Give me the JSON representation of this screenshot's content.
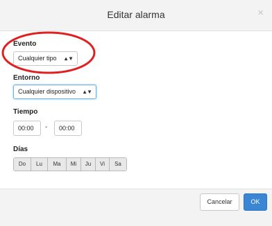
{
  "dialog": {
    "title": "Editar alarma",
    "close_label": "×"
  },
  "evento": {
    "label": "Evento",
    "value": "Cualquier tipo",
    "arrow": "▲▼"
  },
  "entorno": {
    "label": "Entorno",
    "value": "Cualquier dispositivo",
    "arrow": "▲▼"
  },
  "tiempo": {
    "label": "Tiempo",
    "start": "00:00",
    "separator": "-",
    "end": "00:00"
  },
  "dias": {
    "label": "Días",
    "items": [
      "Do",
      "Lu",
      "Ma",
      "Mi",
      "Ju",
      "Vi",
      "Sa"
    ]
  },
  "footer": {
    "cancel_label": "Cancelar",
    "ok_label": "OK"
  },
  "colors": {
    "primary": "#3a86d5",
    "annotation": "#e02020",
    "focus": "#66afe9"
  }
}
